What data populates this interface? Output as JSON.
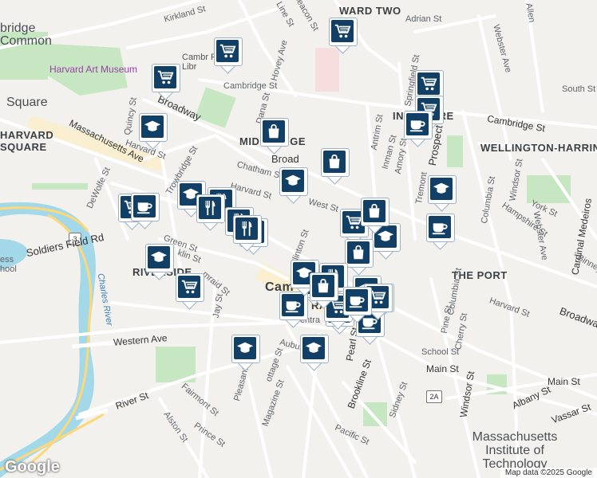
{
  "map": {
    "provider": "Google",
    "attribution": "Map data ©2025 Google",
    "labels": {
      "kirkland": "Kirkland St",
      "beacon": "Beacon St",
      "ward_two": "WARD TWO",
      "adrian": "Adrian St",
      "line": "Line St",
      "bridge": "bridge",
      "common": "Common",
      "museum": "Harvard Art Museum",
      "public_library": "Cambr Public Libr",
      "cambridge_st_w": "Cambridge St",
      "broadway_w": "Broadway",
      "square_w": "Square",
      "harvard_square": "HARVARD SQUARE",
      "mass_ave": "Massachusetts Ave",
      "quincy": "Quincy St",
      "harvard_st_w": "Harvard St",
      "trowbridge": "Trowbridge St",
      "dewolfe": "DeWolfe St",
      "dana": "Dana St",
      "hovey": "Hovey Ave",
      "mid_bridge": "MID BRIDGE",
      "broadway_mid": "Broad",
      "chatham": "Chatham St",
      "harvard_st_mid": "Harvard St",
      "west_st": "West St",
      "antrim": "Antrim St",
      "inman": "Inman St",
      "amory": "Amory St",
      "springfield": "Springfield St",
      "inman_square": "IN SQUARE",
      "cambridge_st_e": "Cambridge St",
      "webster": "Webster Ave",
      "wellington": "WELLINGTON-HARRIN",
      "prospect": "Prospect",
      "columbia_e": "Columbia St",
      "windsor_e": "Windsor St",
      "hampshire": "Hampshire St",
      "york": "York St",
      "webster_ave_e": "Webster Ave",
      "cardinal": "Cardinal Medeiros",
      "binney": "Binney",
      "south": "South St",
      "tremont": "Tremont",
      "the_port": "THE PORT",
      "columbia_mid": "Columbia St",
      "pine": "Pine St",
      "cherry": "Cherry St",
      "harvard_st_e": "Harvard St",
      "broadway_e": "Broadway",
      "school": "School St",
      "main_w": "Main St",
      "main_e": "Main St",
      "windsor_s": "Windsor St",
      "albany": "Albany St",
      "vassar": "Vassar St",
      "mit": "Massachusetts Institute of Technology",
      "clinton": "Clinton St",
      "green": "Green St",
      "franklin": "klin St",
      "riverside": "RIVERSIDE",
      "soldiers_field": "Soldiers Field Rd",
      "charles_river": "Charles River",
      "western": "Western Ave",
      "central": "Centra",
      "cambridge_center": "Cam",
      "central_sq": "RA",
      "auburn": "Auburn",
      "pearl": "Pearl St",
      "brookline": "Brookline St",
      "sidney": "Sidney St",
      "pacific": "Pacific St",
      "magazine": "Magazine St",
      "cottage": "ottage St",
      "pleasant": "Pleasant St",
      "fairmont": "Fairmont St",
      "prince": "Prince St",
      "alston": "Alston St",
      "river_st": "River St",
      "jay": "Jay St",
      "mairad": "mraid St",
      "ess": "ess",
      "hool": "hool",
      "allen": "Allen"
    },
    "shields": {
      "r3": "3",
      "r2a": "2A"
    },
    "markers": [
      {
        "type": "shopping-cart",
        "label": "grocery"
      },
      {
        "type": "shopping-cart",
        "label": "grocery"
      },
      {
        "type": "shopping-cart",
        "label": "grocery"
      },
      {
        "type": "shopping-cart",
        "label": "grocery"
      },
      {
        "type": "shopping-cart",
        "label": "grocery"
      },
      {
        "type": "shopping-cart",
        "label": "grocery"
      },
      {
        "type": "shopping-cart",
        "label": "grocery"
      },
      {
        "type": "shopping-cart",
        "label": "grocery"
      },
      {
        "type": "shopping-cart",
        "label": "grocery"
      },
      {
        "type": "shopping-cart",
        "label": "grocery"
      },
      {
        "type": "graduation-cap",
        "label": "school"
      },
      {
        "type": "graduation-cap",
        "label": "school"
      },
      {
        "type": "graduation-cap",
        "label": "school"
      },
      {
        "type": "graduation-cap",
        "label": "school"
      },
      {
        "type": "graduation-cap",
        "label": "school"
      },
      {
        "type": "graduation-cap",
        "label": "school"
      },
      {
        "type": "graduation-cap",
        "label": "school"
      },
      {
        "type": "graduation-cap",
        "label": "school"
      },
      {
        "type": "graduation-cap",
        "label": "school"
      },
      {
        "type": "shopping-bag",
        "label": "shopping"
      },
      {
        "type": "shopping-bag",
        "label": "shopping"
      },
      {
        "type": "shopping-bag",
        "label": "shopping"
      },
      {
        "type": "shopping-bag",
        "label": "shopping"
      },
      {
        "type": "shopping-bag",
        "label": "shopping"
      },
      {
        "type": "coffee-cup",
        "label": "cafe"
      },
      {
        "type": "coffee-cup",
        "label": "cafe"
      },
      {
        "type": "coffee-cup",
        "label": "cafe"
      },
      {
        "type": "coffee-cup",
        "label": "cafe"
      },
      {
        "type": "coffee-cup",
        "label": "cafe"
      },
      {
        "type": "fork-knife",
        "label": "restaurant"
      },
      {
        "type": "fork-knife",
        "label": "restaurant"
      },
      {
        "type": "fork-knife",
        "label": "restaurant"
      },
      {
        "type": "fork-knife",
        "label": "restaurant"
      },
      {
        "type": "fork-knife",
        "label": "restaurant"
      },
      {
        "type": "fork-knife",
        "label": "restaurant"
      },
      {
        "type": "shopping-cart",
        "label": "grocery"
      },
      {
        "type": "shopping-cart",
        "label": "grocery"
      },
      {
        "type": "coffee-cup",
        "label": "cafe"
      },
      {
        "type": "graduation-cap",
        "label": "school"
      },
      {
        "type": "shopping-bag",
        "label": "shopping"
      }
    ],
    "colors": {
      "marker_tile": "#123f66",
      "water": "#a3d8e8",
      "park": "#c7e6c2",
      "road": "#ffffff",
      "highway": "#fdd87a"
    }
  }
}
